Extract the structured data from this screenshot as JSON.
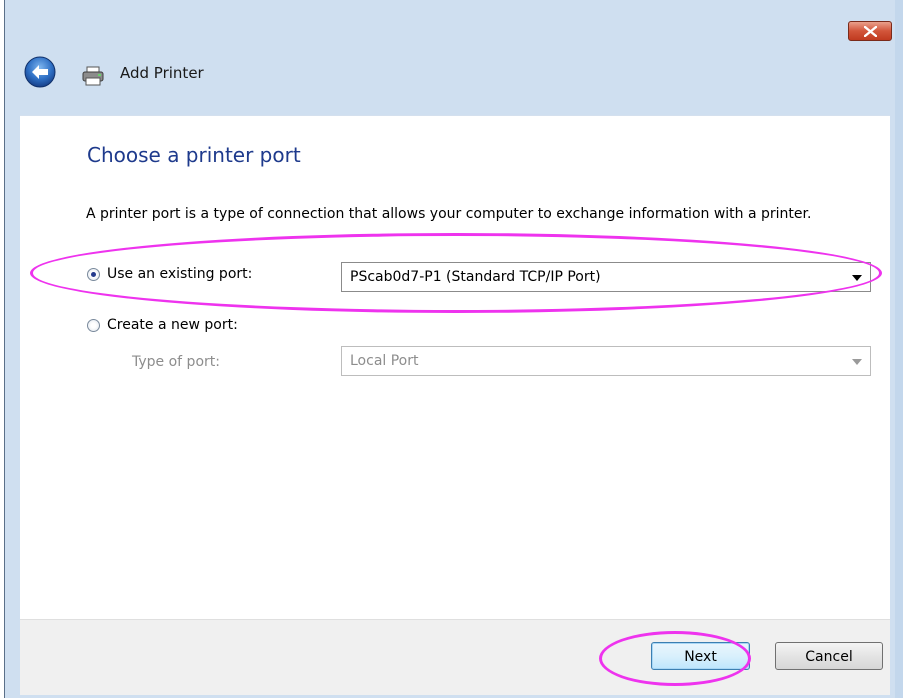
{
  "window": {
    "title": "Add Printer",
    "close_label": "close"
  },
  "page": {
    "title": "Choose a printer port",
    "intro": "A printer port is a type of connection that allows your computer to exchange information with a printer."
  },
  "options": {
    "existing": {
      "label": "Use an existing port:",
      "selected": true,
      "value": "PScab0d7-P1 (Standard TCP/IP Port)"
    },
    "create": {
      "label": "Create a new port:",
      "selected": false,
      "type_label": "Type of port:",
      "type_value": "Local Port"
    }
  },
  "buttons": {
    "next": "Next",
    "cancel": "Cancel"
  },
  "colors": {
    "annotation": "#ee33ee",
    "title_blue": "#1e3a8c"
  }
}
